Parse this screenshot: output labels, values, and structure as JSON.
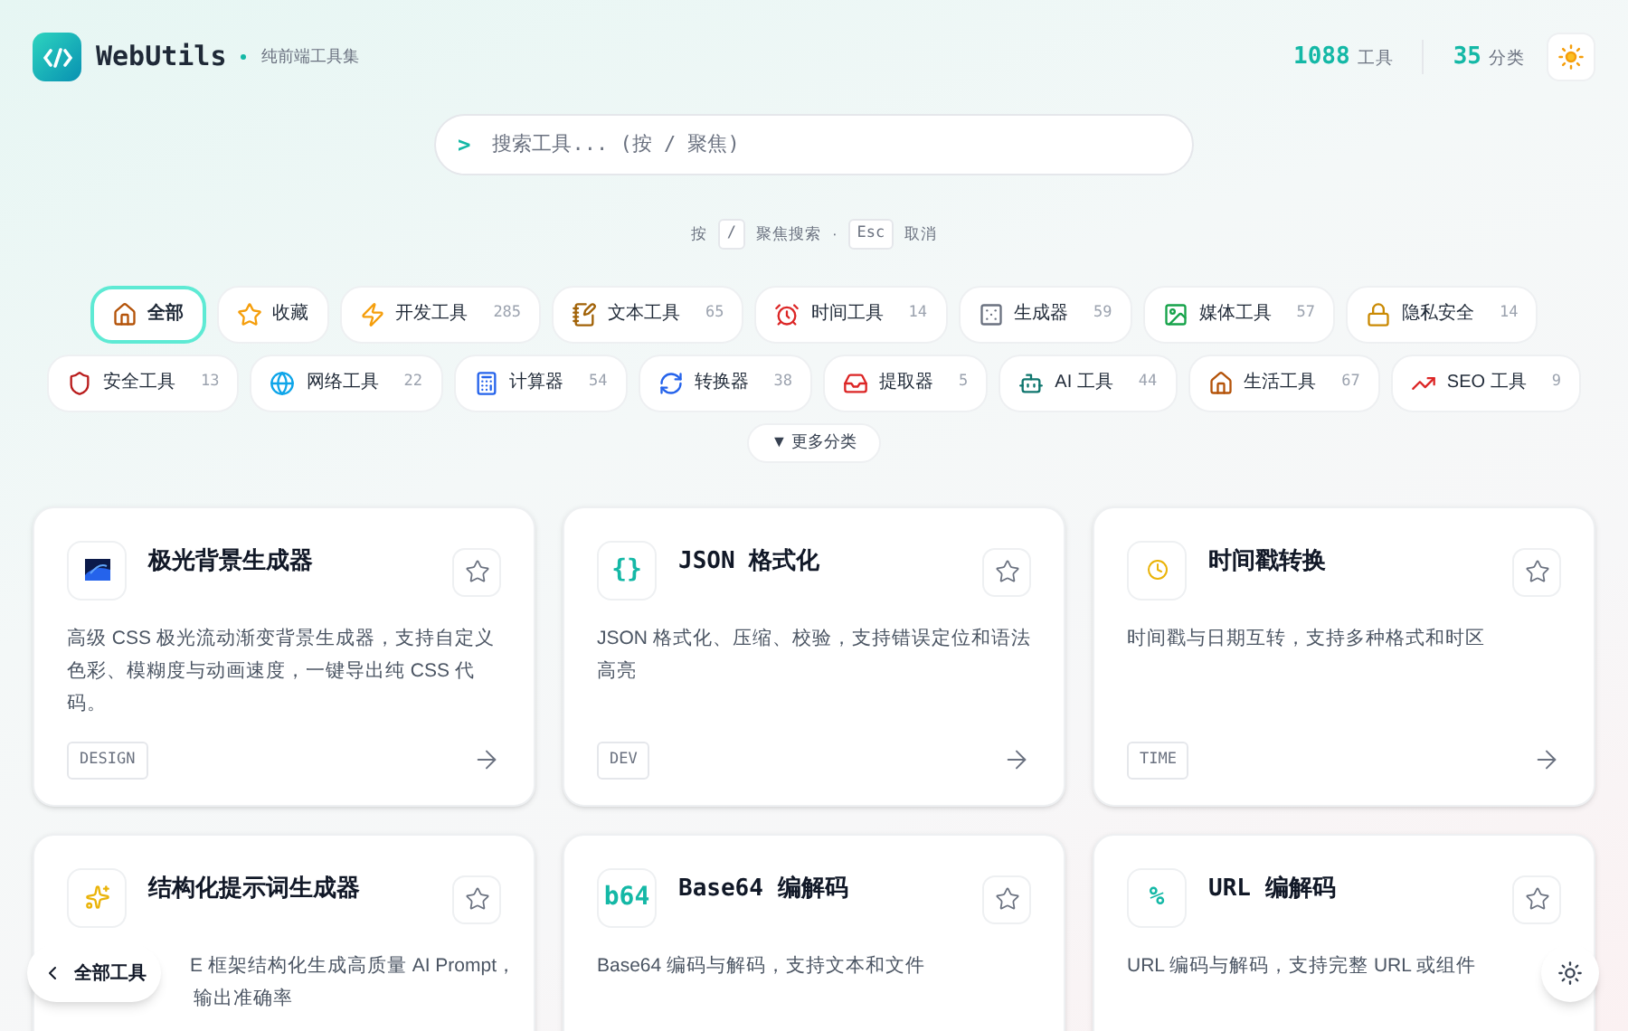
{
  "brand": {
    "name": "WebUtils",
    "tagline": "纯前端工具集"
  },
  "stats": [
    {
      "value": "1088",
      "label": "工具"
    },
    {
      "value": "35",
      "label": "分类"
    }
  ],
  "search": {
    "prompt": ">",
    "placeholder": "搜索工具... (按 / 聚焦)"
  },
  "hint": {
    "press": "按",
    "key1": "/",
    "focus": "聚焦搜索",
    "sep": "·",
    "key2": "Esc",
    "cancel": "取消"
  },
  "categories": [
    {
      "label": "全部",
      "selected": true
    },
    {
      "label": "收藏",
      "selected": false
    },
    {
      "label": "开发工具",
      "count": "285",
      "selected": false
    },
    {
      "label": "文本工具",
      "count": "65",
      "selected": false
    },
    {
      "label": "时间工具",
      "count": "14",
      "selected": false
    },
    {
      "label": "生成器",
      "count": "59",
      "selected": false
    },
    {
      "label": "媒体工具",
      "count": "57",
      "selected": false
    },
    {
      "label": "隐私安全",
      "count": "14",
      "selected": false
    },
    {
      "label": "安全工具",
      "count": "13",
      "selected": false
    },
    {
      "label": "网络工具",
      "count": "22",
      "selected": false
    },
    {
      "label": "计算器",
      "count": "54",
      "selected": false
    },
    {
      "label": "转换器",
      "count": "38",
      "selected": false
    },
    {
      "label": "提取器",
      "count": "5",
      "selected": false
    },
    {
      "label": "AI 工具",
      "count": "44",
      "selected": false
    },
    {
      "label": "生活工具",
      "count": "67",
      "selected": false
    },
    {
      "label": "SEO 工具",
      "count": "9",
      "selected": false
    }
  ],
  "more": {
    "label": "▼ 更多分类"
  },
  "tools": [
    {
      "kind": "picture",
      "title": "极光背景生成器",
      "description": [
        "高级 CSS 极光流动渐变背景生成器，支持自定义色彩、模糊度与动画速度，一键导出纯 CSS 代码。"
      ],
      "tag": "DESIGN"
    },
    {
      "kind": "glyph",
      "glyph": "{}",
      "title": "JSON 格式化",
      "description": [
        "JSON 格式化、压缩、校验，支持错误定位和语法高亮"
      ],
      "tag": "DEV"
    },
    {
      "kind": "clock",
      "title": "时间戳转换",
      "description": [
        "时间戳与日期互转，支持多种格式和时区"
      ],
      "tag": "TIME"
    },
    {
      "kind": "sparkle",
      "title": "结构化提示词生成器",
      "description": [
        "E 框架结构化生成高质量 AI Prompt，",
        "输出准确率"
      ]
    },
    {
      "kind": "glyph",
      "glyph": "b64",
      "title": "Base64 编解码",
      "description": [
        "Base64 编码与解码，支持文本和文件"
      ]
    },
    {
      "kind": "glyph",
      "glyph": "%",
      "title": "URL 编解码",
      "description": [
        "URL 编码与解码，支持完整 URL 或组件"
      ]
    }
  ],
  "back_button": {
    "label": "全部工具"
  }
}
